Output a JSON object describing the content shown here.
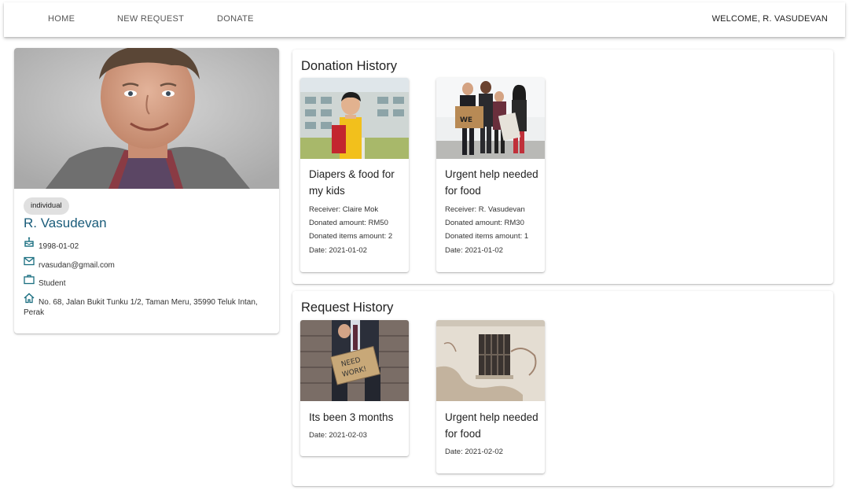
{
  "nav": {
    "home": "HOME",
    "new_request": "NEW REQUEST",
    "donate": "DONATE",
    "welcome": "WELCOME, R. VASUDEVAN"
  },
  "profile": {
    "type_chip": "individual",
    "name": "R. Vasudevan",
    "birthdate": "1998-01-02",
    "email": "rvasudan@gmail.com",
    "occupation": "Student",
    "address_line1": "No. 68, Jalan Bukit Tunku 1/2, Taman Meru, 35990 Teluk Intan,",
    "address_line2": "Perak",
    "icons": [
      "cake-icon",
      "email-icon",
      "briefcase-icon",
      "home-icon"
    ]
  },
  "donation_history": {
    "title": "Donation History",
    "cards": [
      {
        "title": "Diapers & food for my kids",
        "receiver": "Receiver: Claire Mok",
        "amount": "Donated amount: RM50",
        "items": "Donated items amount: 2",
        "date": "Date: 2021-01-02"
      },
      {
        "title": "Urgent help needed for food",
        "receiver": "Receiver: R. Vasudevan",
        "amount": "Donated amount: RM30",
        "items": "Donated items amount: 1",
        "date": "Date: 2021-01-02"
      }
    ]
  },
  "request_history": {
    "title": "Request History",
    "cards": [
      {
        "title": "Its been 3 months",
        "date": "Date: 2021-02-03"
      },
      {
        "title": "Urgent help needed for food",
        "date": "Date: 2021-02-02"
      }
    ],
    "sign_text": "NEED WORK!"
  },
  "colors": {
    "accent": "#1a5c7a",
    "icon": "#1a6e80",
    "chip": "#e0e0e0"
  }
}
